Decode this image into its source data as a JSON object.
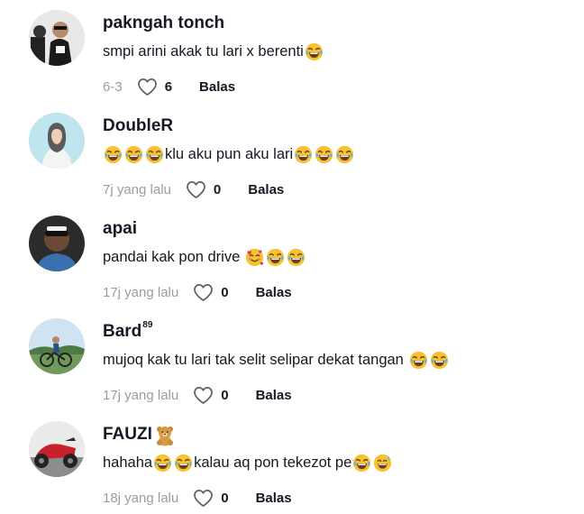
{
  "comments": [
    {
      "username": "pakngah tonch",
      "text": "smpi arini akak tu lari x berenti",
      "time": "6-3",
      "likes": "6",
      "reply": "Balas",
      "avatar_icon": "person-mask-photo"
    },
    {
      "username": "DoubleR",
      "text_mid": "klu aku pun aku lari",
      "time": "7j yang lalu",
      "likes": "0",
      "reply": "Balas",
      "avatar_icon": "hijab-woman-illustration"
    },
    {
      "username": "apai",
      "text": "pandai kak pon drive",
      "time": "17j yang lalu",
      "likes": "0",
      "reply": "Balas",
      "avatar_icon": "man-selfie-photo"
    },
    {
      "username": "Bard",
      "username_sup": "89",
      "text": "mujoq kak tu lari tak selit selipar dekat tangan",
      "time": "17j yang lalu",
      "likes": "0",
      "reply": "Balas",
      "avatar_icon": "cyclist-photo"
    },
    {
      "username": "FAUZI",
      "text_a": "hahaha",
      "text_b": "kalau aq pon tekezot pe",
      "time": "18j yang lalu",
      "likes": "0",
      "reply": "Balas",
      "avatar_icon": "motorcycle-photo"
    }
  ],
  "icons": {
    "like": "heart-outline-icon",
    "laugh": "tears-of-joy-emoji",
    "love": "smiling-hearts-emoji",
    "sweat": "grinning-sweat-emoji",
    "bear": "teddy-bear-emoji"
  },
  "colors": {
    "text": "#161823",
    "muted": "#9b9ca3",
    "emoji": "#f6c230"
  }
}
